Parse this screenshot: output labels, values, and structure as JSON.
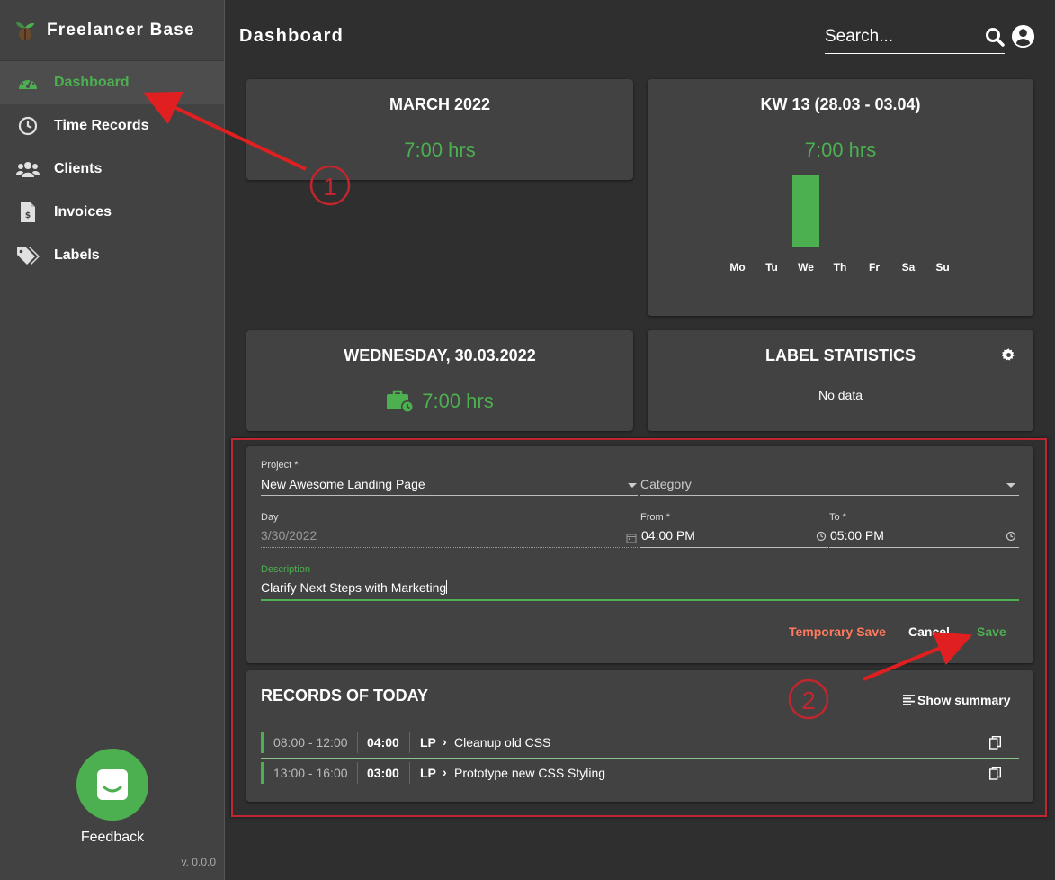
{
  "app": {
    "title": "Freelancer Base",
    "version": "v. 0.0.0"
  },
  "sidebar": {
    "items": [
      {
        "label": "Dashboard",
        "icon": "speedometer-icon",
        "active": true
      },
      {
        "label": "Time Records",
        "icon": "clock-icon"
      },
      {
        "label": "Clients",
        "icon": "users-icon"
      },
      {
        "label": "Invoices",
        "icon": "invoice-icon"
      },
      {
        "label": "Labels",
        "icon": "tags-icon"
      }
    ],
    "feedback_label": "Feedback"
  },
  "header": {
    "title": "Dashboard",
    "search_placeholder": "Search..."
  },
  "cards": {
    "month": {
      "title": "MARCH 2022",
      "hours": "7:00 hrs"
    },
    "week": {
      "title": "KW 13 (28.03 - 03.04)",
      "hours": "7:00 hrs",
      "days": [
        "Mo",
        "Tu",
        "We",
        "Th",
        "Fr",
        "Sa",
        "Su"
      ],
      "values": [
        0,
        0,
        7,
        0,
        0,
        0,
        0
      ]
    },
    "day": {
      "title": "WEDNESDAY, 30.03.2022",
      "hours": "7:00 hrs"
    },
    "labels": {
      "title": "LABEL STATISTICS",
      "empty_text": "No data"
    }
  },
  "form": {
    "project_label": "Project *",
    "project_value": "New Awesome Landing Page",
    "category_placeholder": "Category",
    "day_label": "Day",
    "day_value": "3/30/2022",
    "from_label": "From *",
    "from_value": "04:00 PM",
    "to_label": "To *",
    "to_value": "05:00 PM",
    "description_label": "Description",
    "description_value": "Clarify Next Steps with Marketing",
    "temp_save": "Temporary Save",
    "cancel": "Cancel",
    "save": "Save"
  },
  "records": {
    "title": "RECORDS OF TODAY",
    "show_summary": "Show summary",
    "rows": [
      {
        "time": "08:00 - 12:00",
        "duration": "04:00",
        "project": "LP",
        "task": "Cleanup old CSS"
      },
      {
        "time": "13:00 - 16:00",
        "duration": "03:00",
        "project": "LP",
        "task": "Prototype new CSS Styling"
      }
    ]
  },
  "annotations": {
    "one": "1",
    "two": "2"
  },
  "colors": {
    "accent": "#4caf50",
    "warning": "#ff7a5c",
    "annotation": "#e02020"
  }
}
